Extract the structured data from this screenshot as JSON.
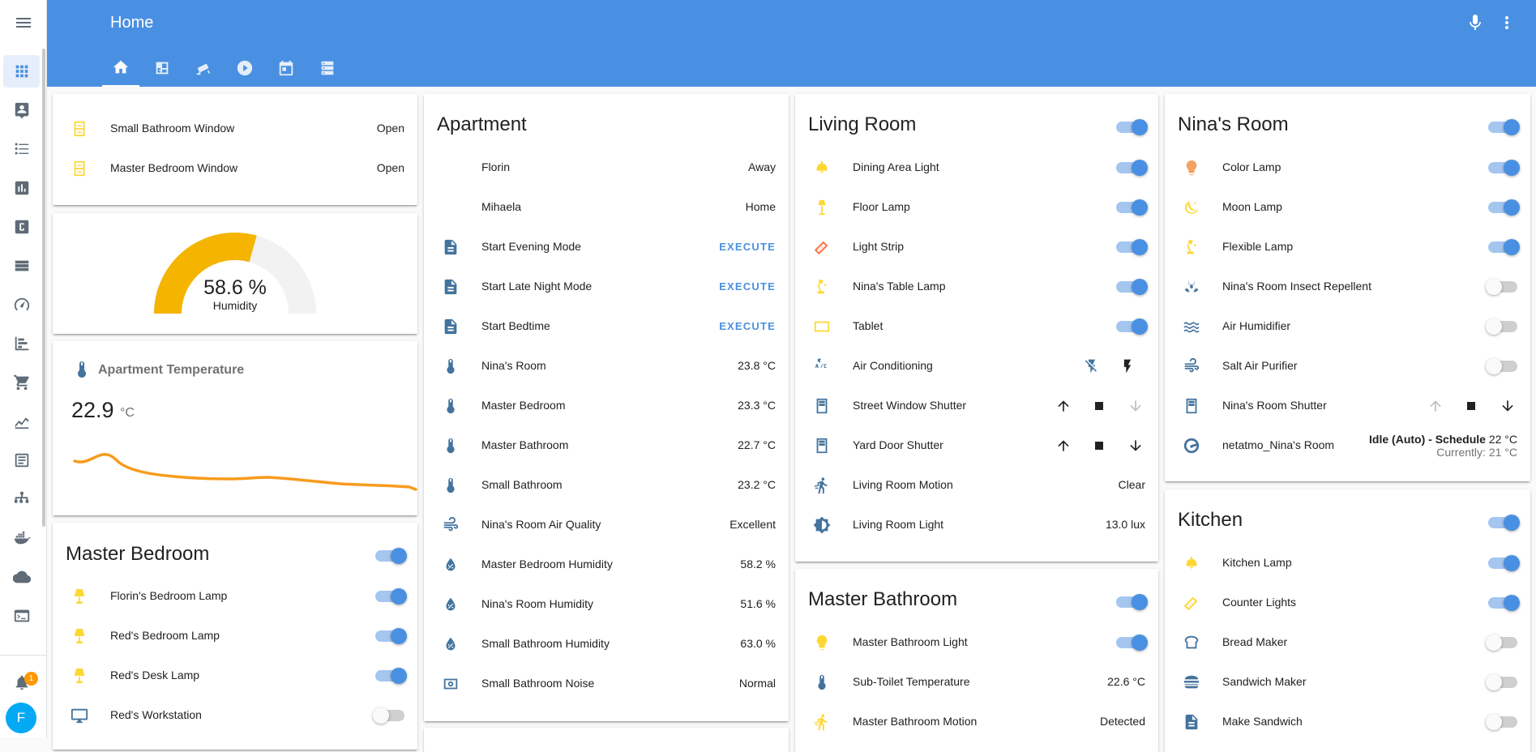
{
  "header": {
    "title": "Home"
  },
  "sidebar": {
    "notification_count": "1",
    "avatar_initial": "F"
  },
  "colors": {
    "primary": "#4a90e2",
    "state_on": "#fdd835",
    "text": "#212121"
  },
  "windows": {
    "rows": [
      {
        "name": "Small Bathroom Window",
        "state": "Open"
      },
      {
        "name": "Master Bedroom Window",
        "state": "Open"
      }
    ]
  },
  "humidity": {
    "value": "58.6 %",
    "label": "Humidity",
    "percent": 58.6
  },
  "temperature": {
    "title": "Apartment Temperature",
    "value": "22.9",
    "unit": "°C"
  },
  "master_bedroom": {
    "title": "Master Bedroom",
    "rows": [
      "Florin's Bedroom Lamp",
      "Red's Bedroom Lamp",
      "Red's Desk Lamp",
      "Red's Workstation"
    ]
  },
  "apartment": {
    "title": "Apartment",
    "rows": [
      {
        "name": "Florin",
        "state": "Away"
      },
      {
        "name": "Mihaela",
        "state": "Home"
      },
      {
        "name": "Start Evening Mode",
        "state": "EXECUTE"
      },
      {
        "name": "Start Late Night Mode",
        "state": "EXECUTE"
      },
      {
        "name": "Start Bedtime",
        "state": "EXECUTE"
      },
      {
        "name": "Nina's Room",
        "state": "23.8 °C"
      },
      {
        "name": "Master Bedroom",
        "state": "23.3 °C"
      },
      {
        "name": "Master Bathroom",
        "state": "22.7 °C"
      },
      {
        "name": "Small Bathroom",
        "state": "23.2 °C"
      },
      {
        "name": "Nina's Room Air Quality",
        "state": "Excellent"
      },
      {
        "name": "Master Bedroom Humidity",
        "state": "58.2 %"
      },
      {
        "name": "Nina's Room Humidity",
        "state": "51.6 %"
      },
      {
        "name": "Small Bathroom Humidity",
        "state": "63.0 %"
      },
      {
        "name": "Small Bathroom Noise",
        "state": "Normal"
      }
    ]
  },
  "living_room": {
    "title": "Living Room",
    "rows": [
      {
        "name": "Dining Area Light"
      },
      {
        "name": "Floor Lamp"
      },
      {
        "name": "Light Strip"
      },
      {
        "name": "Nina's Table Lamp"
      },
      {
        "name": "Tablet"
      },
      {
        "name": "Air Conditioning"
      },
      {
        "name": "Street Window Shutter"
      },
      {
        "name": "Yard Door Shutter"
      },
      {
        "name": "Living Room Motion",
        "state": "Clear"
      },
      {
        "name": "Living Room Light",
        "state": "13.0 lux"
      }
    ]
  },
  "master_bathroom": {
    "title": "Master Bathroom",
    "rows": [
      {
        "name": "Master Bathroom Light"
      },
      {
        "name": "Sub-Toilet Temperature",
        "state": "22.6 °C"
      },
      {
        "name": "Master Bathroom Motion",
        "state": "Detected"
      }
    ]
  },
  "ninas_room": {
    "title": "Nina's Room",
    "rows": [
      {
        "name": "Color Lamp"
      },
      {
        "name": "Moon Lamp"
      },
      {
        "name": "Flexible Lamp"
      },
      {
        "name": "Nina's Room Insect Repellent"
      },
      {
        "name": "Air Humidifier"
      },
      {
        "name": "Salt Air Purifier"
      },
      {
        "name": "Nina's Room Shutter"
      },
      {
        "name": "netatmo_Nina's Room",
        "state_main": "Idle (Auto) - Schedule",
        "state_temp": "22 °C",
        "state_current": "Currently: 21 °C"
      }
    ]
  },
  "kitchen": {
    "title": "Kitchen",
    "rows": [
      "Kitchen Lamp",
      "Counter Lights",
      "Bread Maker",
      "Sandwich Maker",
      "Make Sandwich"
    ]
  }
}
